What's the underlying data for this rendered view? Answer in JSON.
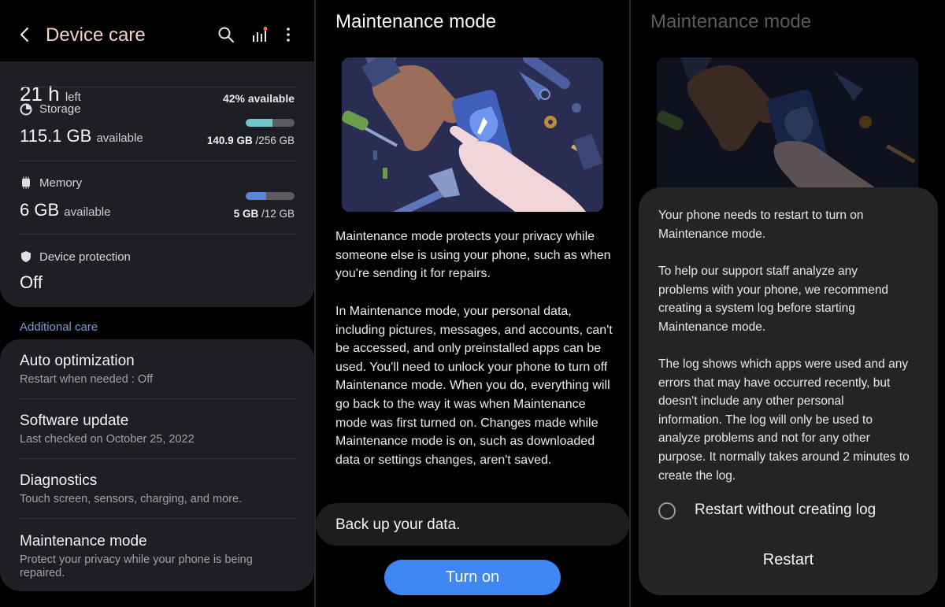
{
  "device_care": {
    "header": {
      "title": "Device care",
      "icons": [
        "back-icon",
        "search-icon",
        "battery-stats-icon",
        "more-icon"
      ]
    },
    "battery": {
      "remaining_partial": "21 h",
      "remaining_unit": "left",
      "available": "42% available"
    },
    "storage": {
      "label": "Storage",
      "value": "115.1 GB",
      "value_suffix": "available",
      "used": "140.9 GB",
      "total": "/256 GB",
      "used_fraction": 0.55,
      "bar_color": "#6fc7c9"
    },
    "memory": {
      "label": "Memory",
      "value": "6 GB",
      "value_suffix": "available",
      "used": "5 GB",
      "total": "/12 GB",
      "used_fraction": 0.42,
      "bar_color": "#5a86d6"
    },
    "device_protection": {
      "label": "Device protection",
      "value": "Off"
    },
    "additional_care": {
      "heading": "Additional care",
      "items": [
        {
          "title": "Auto optimization",
          "subtitle": "Restart when needed : Off"
        },
        {
          "title": "Software update",
          "subtitle": "Last checked on October 25, 2022"
        },
        {
          "title": "Diagnostics",
          "subtitle": "Touch screen, sensors, charging, and more."
        },
        {
          "title": "Maintenance mode",
          "subtitle": "Protect your privacy while your phone is being repaired."
        }
      ]
    }
  },
  "maintenance_info": {
    "title": "Maintenance mode",
    "paragraph1": "Maintenance mode protects your privacy while someone else is using your phone, such as when you're sending it for repairs.",
    "paragraph2": "In Maintenance mode, your personal data, including pictures, messages, and accounts, can't be accessed, and only preinstalled apps can be used. You'll need to unlock your phone to turn off Maintenance mode. When you do, everything will go back to the way it was when Maintenance mode was first turned on. Changes made while Maintenance mode is on, such as downloaded data or settings changes, aren't saved.",
    "backup_label": "Back up your data.",
    "turn_on_label": "Turn on",
    "accent_color": "#3e86f2"
  },
  "restart_dialog": {
    "background_title": "Maintenance mode",
    "paragraph1": "Your phone needs to restart to turn on Maintenance mode.",
    "paragraph2": "To help our support staff analyze any problems with your phone, we recommend creating a system log before starting Maintenance mode.",
    "paragraph3": "The log shows which apps were used and any errors that may have occurred recently, but doesn't include any other personal information. The log will only be used to analyze problems and not for any other purpose. It normally takes around 2 minutes to create the log.",
    "radio_label": "Restart without creating log",
    "radio_checked": false,
    "restart_label": "Restart"
  }
}
